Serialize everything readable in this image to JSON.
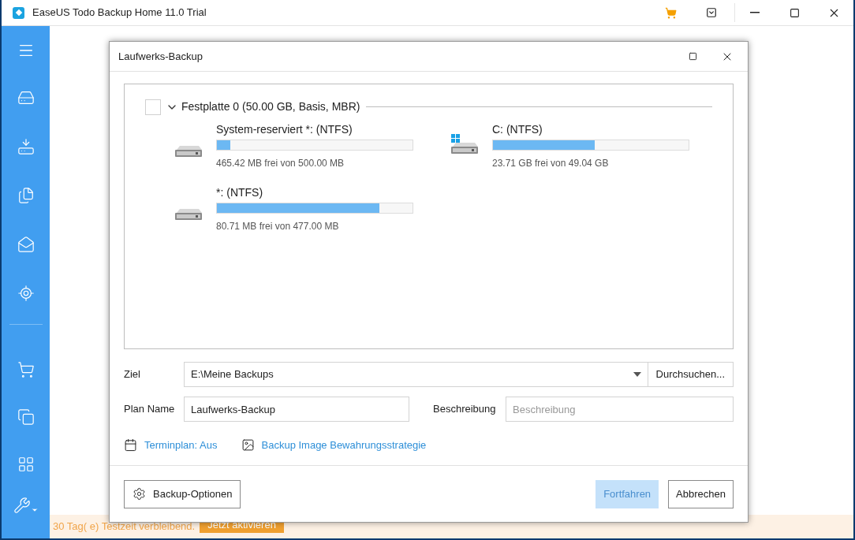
{
  "window": {
    "title": "EaseUS Todo Backup Home 11.0 Trial"
  },
  "trial_bar": {
    "message": "30 Tag( e) Testzeit verbleibend.",
    "button": "Jetzt aktivieren"
  },
  "dialog": {
    "title": "Laufwerks-Backup",
    "disk": {
      "label": "Festplatte 0 (50.00 GB, Basis, MBR)",
      "checked": false,
      "expanded": true,
      "partitions": [
        {
          "name": "System-reserviert *: (NTFS)",
          "kind": "plain",
          "level": 0.07,
          "free": "465.42 MB frei von 500.00 MB"
        },
        {
          "name": "C: (NTFS)",
          "kind": "system",
          "level": 0.52,
          "free": "23.71 GB frei von 49.04 GB"
        },
        {
          "name": "*: (NTFS)",
          "kind": "plain",
          "level": 0.83,
          "free": "80.71 MB frei von 477.00 MB"
        }
      ]
    },
    "target": {
      "label": "Ziel",
      "value": "E:\\Meine Backups",
      "browse": "Durchsuchen..."
    },
    "plan_name": {
      "label": "Plan Name",
      "value": "Laufwerks-Backup"
    },
    "description": {
      "label": "Beschreibung",
      "placeholder": "Beschreibung"
    },
    "links": [
      {
        "kind": "schedule",
        "label": "Terminplan: Aus"
      },
      {
        "kind": "image",
        "label": "Backup Image Bewahrungsstrategie"
      }
    ],
    "options_button": "Backup-Optionen",
    "continue_button": {
      "label": "Fortfahren",
      "disabled": true
    },
    "cancel_button": "Abbrechen"
  }
}
